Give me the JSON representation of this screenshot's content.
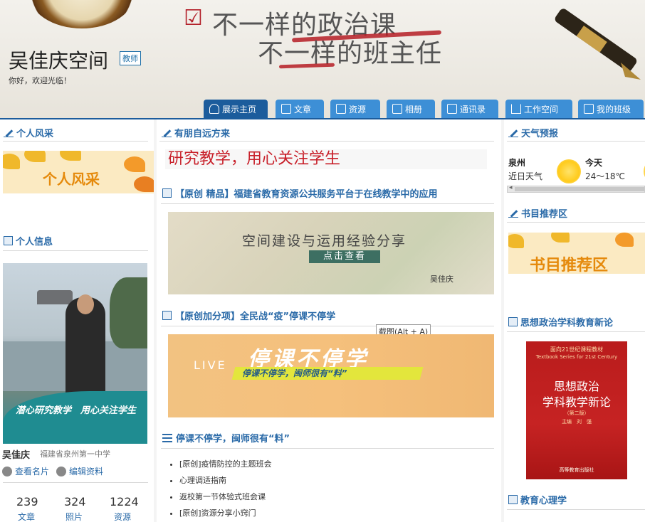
{
  "header": {
    "slogan_line1": "不一样的政治课",
    "slogan_line2": "不一样的班主任",
    "site_title": "吴佳庆空间",
    "role_badge": "教师",
    "welcome": "你好，欢迎光临！"
  },
  "nav": {
    "tabs": [
      {
        "label": "展示主页",
        "icon": "person-icon",
        "active": true
      },
      {
        "label": "文章",
        "icon": "document-icon"
      },
      {
        "label": "资源",
        "icon": "file-icon"
      },
      {
        "label": "相册",
        "icon": "camera-icon"
      },
      {
        "label": "通讯录",
        "icon": "contacts-icon"
      },
      {
        "label": "工作空间",
        "icon": "home-icon"
      },
      {
        "label": "我的班级",
        "icon": "folder-icon"
      }
    ]
  },
  "left": {
    "personal_style_title": "个人风采",
    "personal_style_banner": "个人风采",
    "personal_info_title": "个人信息",
    "photo_caption": "潜心研究教学　用心关注学生",
    "owner_name": "吴佳庆",
    "school": "福建省泉州第一中学",
    "view_card": "查看名片",
    "edit_profile": "编辑资料",
    "stats": [
      {
        "value": "239",
        "label": "文章"
      },
      {
        "value": "324",
        "label": "照片"
      },
      {
        "value": "1224",
        "label": "资源"
      }
    ]
  },
  "middle": {
    "section_title": "有朋自远方来",
    "motto": "研究教学，用心关注学生",
    "article1_title": "【原创 精品】福建省教育资源公共服务平台于在线教学中的应用",
    "card1_title": "空间建设与运用经验分享",
    "card1_button": "点击查看",
    "card1_author": "吴佳庆",
    "tooltip": "截图(Alt + A)",
    "article2_title": "【原创加分项】全民战“疫”停课不停学",
    "card2_live": "LIVE",
    "card2_big": "停课不停学",
    "card2_sub": "停课不停学，闽师很有“料”",
    "list_title": "停课不停学，闽师很有“料”",
    "list_items": [
      "[原创]疫情防控的主题班会",
      "心理调适指南",
      "返校第一节体验式班会课",
      "[原创]资源分享小窍门"
    ]
  },
  "right": {
    "weather_title": "天气预报",
    "city": "泉州",
    "recent": "近日天气",
    "day": "今天",
    "temp": "24～18℃",
    "book_section_title": "书目推荐区",
    "book_banner": "书目推荐区",
    "book1_section_title": "思想政治学科教育新论",
    "book_cover_series": "面向21世纪课程教材",
    "book_cover_series_en": "Textbook Series for 21st Century",
    "book_cover_title1": "思想政治",
    "book_cover_title2": "学科教学新论",
    "book_cover_edition": "（第二版）",
    "book_cover_author": "主编　刘　强",
    "book_cover_publisher": "高等教育出版社",
    "psych_section_title": "教育心理学"
  },
  "colors": {
    "nav_blue": "#3d8fd6",
    "nav_active": "#1c5c9c",
    "section_blue": "#2a6aa8",
    "motto_red": "#c8202a"
  }
}
